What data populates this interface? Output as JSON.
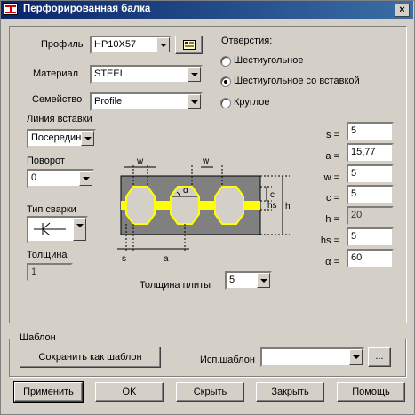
{
  "window": {
    "title": "Перфорированная балка",
    "close_glyph": "×",
    "icon": "beam-app-icon"
  },
  "profile": {
    "label": "Профиль",
    "value": "HP10X57",
    "browse_icon": "catalog-icon"
  },
  "material": {
    "label": "Материал",
    "value": "STEEL"
  },
  "family": {
    "label": "Семейство",
    "value": "Profile"
  },
  "holes": {
    "label": "Отверстия:",
    "options": [
      {
        "label": "Шестиугольное",
        "selected": false
      },
      {
        "label": "Шестиугольное со вставкой",
        "selected": true
      },
      {
        "label": "Круглое",
        "selected": false
      }
    ]
  },
  "insert_line": {
    "label": "Линия вставки",
    "value": "Посередин"
  },
  "rotation": {
    "label": "Поворот",
    "value": "0"
  },
  "weld": {
    "label": "Тип сварки",
    "icon": "weld-symbol-icon"
  },
  "thickness": {
    "label": "Толщина",
    "value": "1"
  },
  "plate_thickness": {
    "label": "Толщина плиты",
    "value": "5"
  },
  "params": [
    {
      "label": "s =",
      "value": "5",
      "editable": true
    },
    {
      "label": "a =",
      "value": "15,77",
      "editable": true
    },
    {
      "label": "w =",
      "value": "5",
      "editable": true
    },
    {
      "label": "c =",
      "value": "5",
      "editable": true
    },
    {
      "label": "h =",
      "value": "20",
      "editable": false
    },
    {
      "label": "hs =",
      "value": "5",
      "editable": true
    },
    {
      "label": "α =",
      "value": "60",
      "editable": true
    }
  ],
  "diagram": {
    "w_top_left": "w",
    "w_top_right": "w",
    "alpha": "α",
    "c": "c",
    "hs": "hs",
    "h": "h",
    "s": "s",
    "a": "a",
    "colors": {
      "plate": "#808080",
      "hole": "#d4d0c8",
      "insert": "#ffff00"
    }
  },
  "template": {
    "group_label": "Шаблон",
    "save_button": "Сохранить как шаблон",
    "use_label": "Исп.шаблон",
    "use_value": "",
    "browse_button": "..."
  },
  "buttons": {
    "apply": "Применить",
    "ok": "OK",
    "hide": "Скрыть",
    "close": "Закрыть",
    "help": "Помощь"
  }
}
